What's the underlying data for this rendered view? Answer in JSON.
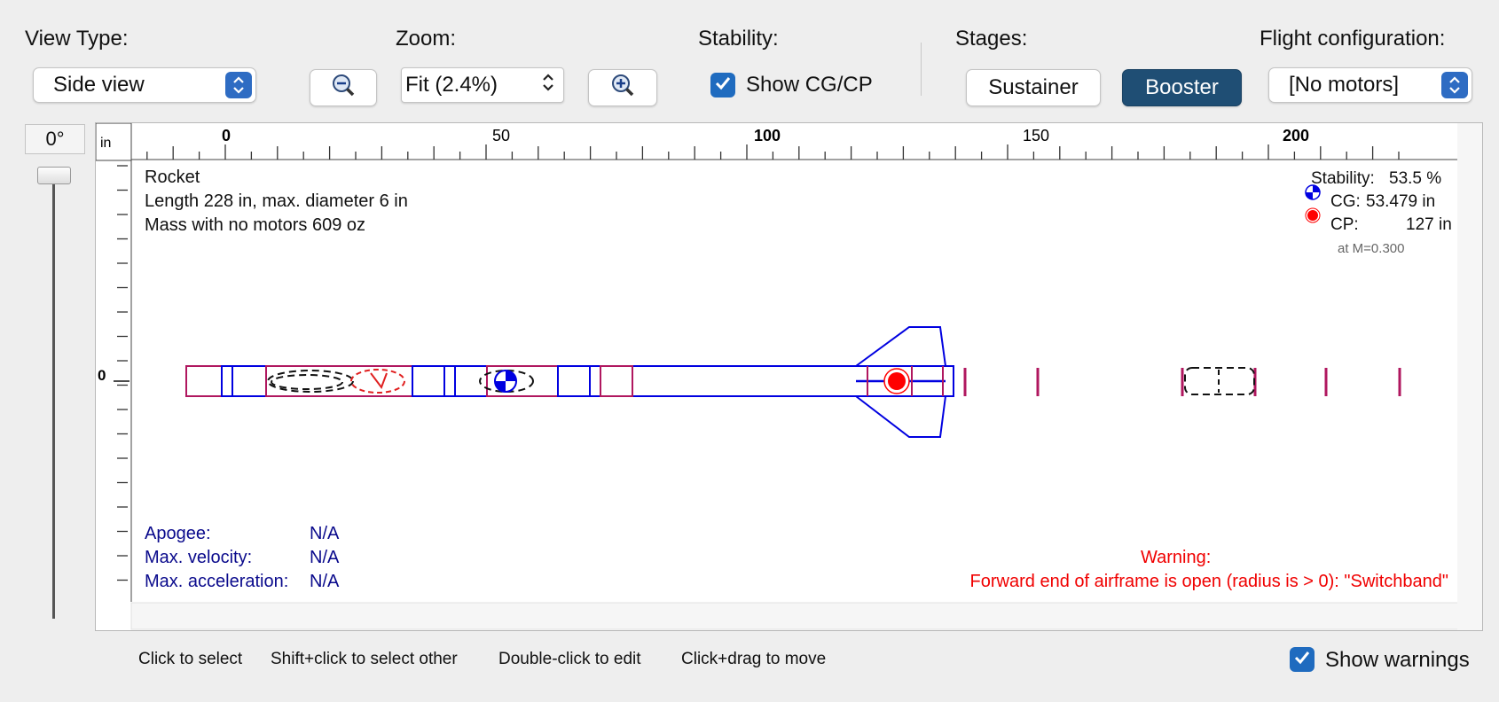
{
  "toolbar": {
    "view_type_label": "View Type:",
    "view_type_value": "Side view",
    "zoom_label": "Zoom:",
    "zoom_value": "Fit (2.4%)",
    "stability_label": "Stability:",
    "show_cgcp_label": "Show CG/CP",
    "show_cgcp_checked": true,
    "stages_label": "Stages:",
    "stage_sustainer": "Sustainer",
    "stage_booster": "Booster",
    "flight_config_label": "Flight configuration:",
    "flight_config_value": "[No motors]"
  },
  "rotation": {
    "value": "0°"
  },
  "ruler": {
    "unit": "in",
    "labels": [
      "0",
      "50",
      "100",
      "150",
      "200"
    ],
    "vertical_zero": "0"
  },
  "rocket_info": {
    "name": "Rocket",
    "length_line": "Length 228 in, max. diameter 6 in",
    "mass_line": "Mass with no motors 609 oz"
  },
  "stability_info": {
    "stability_label": "Stability:",
    "stability_value": "53.5 %",
    "cg_label": "CG:",
    "cg_value": "53.479 in",
    "cp_label": "CP:",
    "cp_value": "127 in",
    "mach": "at M=0.300"
  },
  "flight_stats": {
    "apogee_label": "Apogee:",
    "apogee_value": "N/A",
    "max_velocity_label": "Max. velocity:",
    "max_velocity_value": "N/A",
    "max_accel_label": "Max. acceleration:",
    "max_accel_value": "N/A"
  },
  "warning": {
    "title": "Warning:",
    "message": "Forward end of airframe is open (radius is > 0):  \"Switchband\""
  },
  "hints": {
    "click": "Click to select",
    "shift_click": "Shift+click to select other",
    "double_click": "Double-click to edit",
    "drag": "Click+drag to move"
  },
  "show_warnings": {
    "label": "Show warnings",
    "checked": true
  },
  "colors": {
    "component_blue": "#0000e0",
    "component_magenta": "#b0175f",
    "warning_red": "#f00000",
    "stats_blue": "#0a0a8c",
    "booster_button": "#1f4e74"
  }
}
